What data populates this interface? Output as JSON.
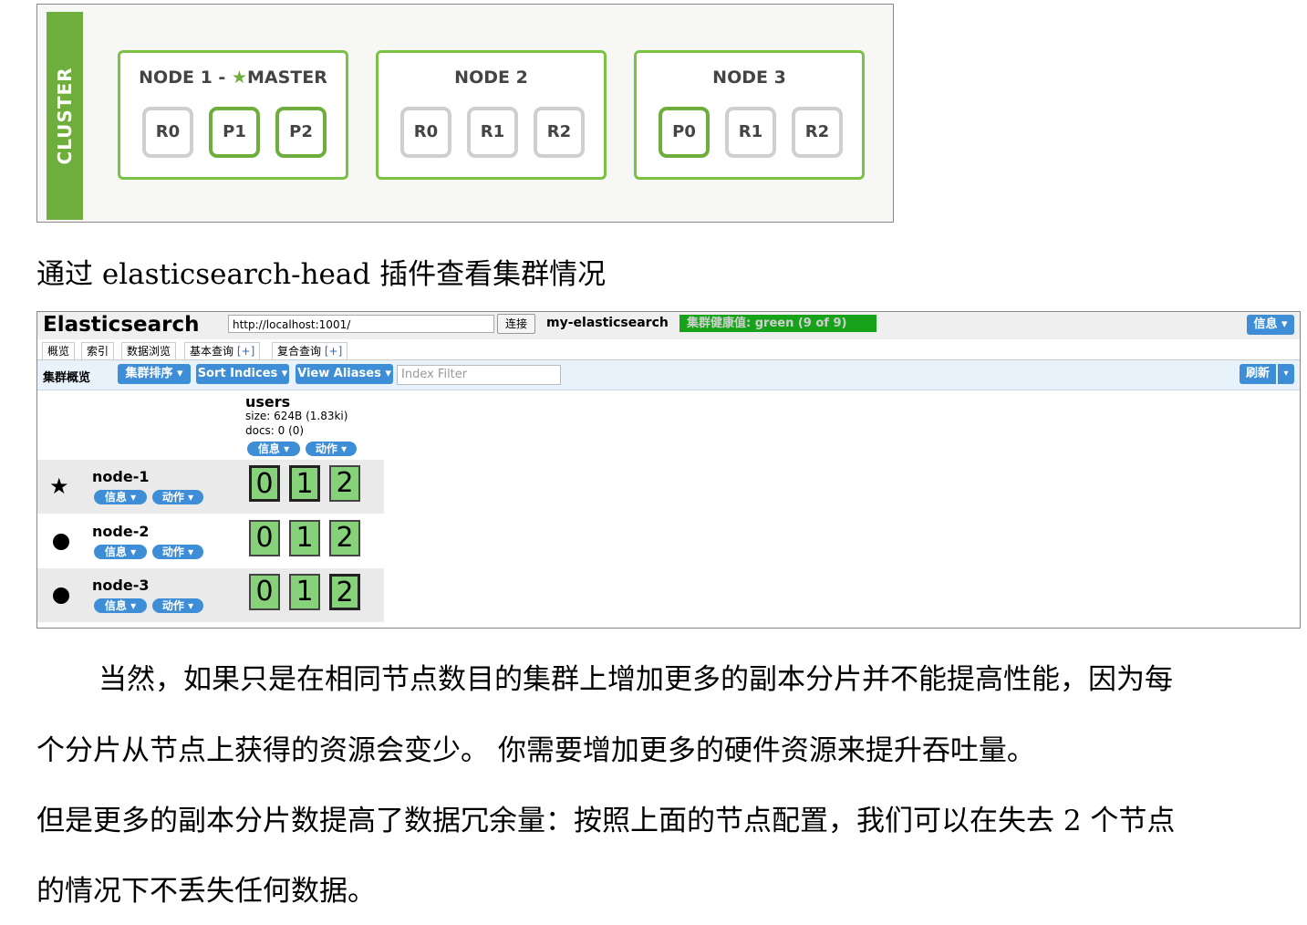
{
  "cluster_diagram": {
    "side_label": "CLUSTER",
    "nodes": [
      {
        "title_prefix": "NODE 1 - ",
        "star": "★",
        "title_suffix": "MASTER",
        "shards": [
          "R0",
          "P1",
          "P2"
        ],
        "primary": [
          false,
          true,
          true
        ]
      },
      {
        "title_prefix": "NODE 2",
        "star": "",
        "title_suffix": "",
        "shards": [
          "R0",
          "R1",
          "R2"
        ],
        "primary": [
          false,
          false,
          false
        ]
      },
      {
        "title_prefix": "NODE 3",
        "star": "",
        "title_suffix": "",
        "shards": [
          "P0",
          "R1",
          "R2"
        ],
        "primary": [
          true,
          false,
          false
        ]
      }
    ],
    "colors": {
      "accent": "#6dae3d",
      "replica_border": "#cfcfcf"
    }
  },
  "caption": "通过 elasticsearch-head 插件查看集群情况",
  "es_head": {
    "logo": "Elasticsearch",
    "url": "http://localhost:1001/",
    "connect_label": "连接",
    "cluster_name": "my-elasticsearch",
    "health": "集群健康值: green (9 of 9)",
    "info_button": "信息 ▾",
    "tabs": [
      {
        "label": "概览",
        "plus": ""
      },
      {
        "label": "索引",
        "plus": ""
      },
      {
        "label": "数据浏览",
        "plus": ""
      },
      {
        "label": "基本查询 ",
        "plus": "[+]"
      },
      {
        "label": "复合查询 ",
        "plus": "[+]"
      }
    ],
    "toolbar": {
      "title": "集群概览",
      "sort_cluster": "集群排序 ▾",
      "sort_indices": "Sort Indices ▾",
      "view_aliases": "View Aliases ▾",
      "filter_placeholder": "Index Filter",
      "refresh": "刷新",
      "refresh_drop": "▾"
    },
    "index": {
      "name": "users",
      "size": "size: 624B (1.83ki)",
      "docs": "docs: 0 (0)",
      "info_pill": "信息 ▾",
      "action_pill": "动作 ▾"
    },
    "nodes": [
      {
        "name": "node-1",
        "master": true,
        "info": "信息 ▾",
        "action": "动作 ▾",
        "shards": [
          "0",
          "1",
          "2"
        ],
        "primary": [
          true,
          true,
          false
        ]
      },
      {
        "name": "node-2",
        "master": false,
        "info": "信息 ▾",
        "action": "动作 ▾",
        "shards": [
          "0",
          "1",
          "2"
        ],
        "primary": [
          false,
          false,
          false
        ]
      },
      {
        "name": "node-3",
        "master": false,
        "info": "信息 ▾",
        "action": "动作 ▾",
        "shards": [
          "0",
          "1",
          "2"
        ],
        "primary": [
          false,
          false,
          true
        ]
      }
    ],
    "colors": {
      "button_blue": "#3e8ed7",
      "health_green": "#16a31a",
      "shard_green": "#86d17a"
    }
  },
  "paragraphs": [
    "当然，如果只是在相同节点数目的集群上增加更多的副本分片并不能提高性能，因为每",
    "个分片从节点上获得的资源会变少。 你需要增加更多的硬件资源来提升吞吐量。",
    "但是更多的副本分片数提高了数据冗余量：按照上面的节点配置，我们可以在失去 2 个节点",
    "的情况下不丢失任何数据。"
  ]
}
